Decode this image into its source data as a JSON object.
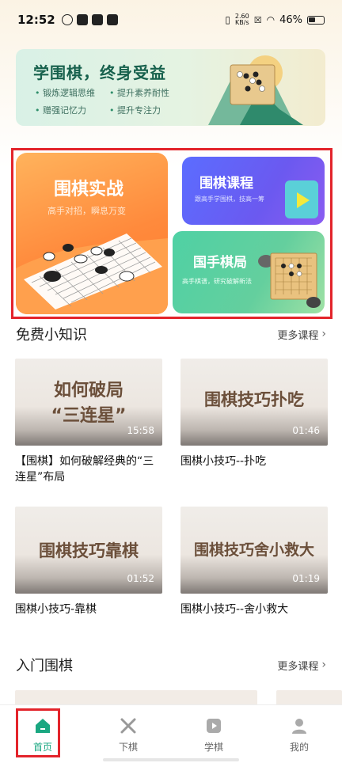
{
  "status_bar": {
    "time": "12:52",
    "net_speed_value": "2.60",
    "net_speed_unit": "KB/s",
    "battery": "46%"
  },
  "banner": {
    "title": "学围棋，终身受益",
    "features": [
      "锻炼逻辑思维",
      "提升素养耐性",
      "赠强记忆力",
      "提升专注力"
    ]
  },
  "cards": {
    "practice": {
      "title": "围棋实战",
      "subtitle": "高手对招，瞬息万变"
    },
    "course": {
      "title": "围棋课程",
      "subtitle": "跟高手学围棋，技高一筹"
    },
    "master": {
      "title": "国手棋局",
      "subtitle": "高手棋谱，研究破解新法"
    }
  },
  "free_tips": {
    "title": "免费小知识",
    "more": "更多课程",
    "videos": [
      {
        "thumb_line1": "如何破局",
        "thumb_line2": "“三连星”",
        "duration": "15:58",
        "title": "【围棋】如何破解经典的“三连星”布局"
      },
      {
        "thumb_line1": "围棋技巧扑吃",
        "thumb_line2": "",
        "duration": "01:46",
        "title": "围棋小技巧--扑吃"
      },
      {
        "thumb_line1": "围棋技巧靠棋",
        "thumb_line2": "",
        "duration": "01:52",
        "title": "围棋小技巧-靠棋"
      },
      {
        "thumb_line1": "围棋技巧舍小救大",
        "thumb_line2": "",
        "duration": "01:19",
        "title": "围棋小技巧--舍小救大"
      }
    ]
  },
  "intro": {
    "title": "入门围棋",
    "more": "更多课程"
  },
  "bottom_nav": [
    {
      "label": "首页",
      "active": true
    },
    {
      "label": "下棋",
      "active": false
    },
    {
      "label": "学棋",
      "active": false
    },
    {
      "label": "我的",
      "active": false
    }
  ],
  "colors": {
    "accent": "#1aa781",
    "highlight": "#e3242b",
    "practice": "#ff8a3c",
    "course": "#6b59f0",
    "master": "#4fd1a4"
  }
}
